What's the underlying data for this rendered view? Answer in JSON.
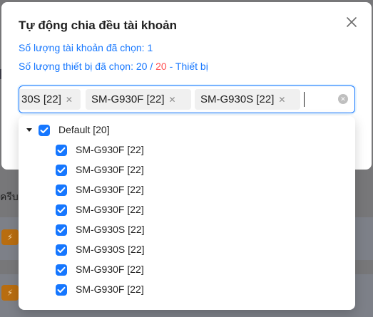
{
  "background": {
    "fragment_text": "ัครีบ",
    "badge_icon": "bolt-icon"
  },
  "modal": {
    "title": "Tự động chia đều tài khoản",
    "accounts_selected": "Số lượng tài khoản đã chọn: 1",
    "devices_selected_prefix": "Số lượng thiết bị đã chọn: 20 / ",
    "devices_total": "20",
    "devices_selected_suffix": " - Thiết bị",
    "close_icon": "close-icon"
  },
  "select": {
    "tags": [
      {
        "label": "30S [22]"
      },
      {
        "label": "SM-G930F [22]"
      },
      {
        "label": "SM-G930S [22]"
      }
    ],
    "clear_icon": "clear-circle-icon"
  },
  "tree": {
    "root": {
      "label": "Default [20]",
      "checked": true,
      "expanded": true
    },
    "children": [
      {
        "label": "SM-G930F [22]",
        "checked": true
      },
      {
        "label": "SM-G930F [22]",
        "checked": true
      },
      {
        "label": "SM-G930F [22]",
        "checked": true
      },
      {
        "label": "SM-G930F [22]",
        "checked": true
      },
      {
        "label": "SM-G930S [22]",
        "checked": true
      },
      {
        "label": "SM-G930S [22]",
        "checked": true
      },
      {
        "label": "SM-G930F [22]",
        "checked": true
      },
      {
        "label": "SM-G930F [22]",
        "checked": true
      }
    ]
  },
  "colors": {
    "accent": "#1677ff",
    "danger": "#ff4d4f",
    "badge": "#b86d10"
  }
}
